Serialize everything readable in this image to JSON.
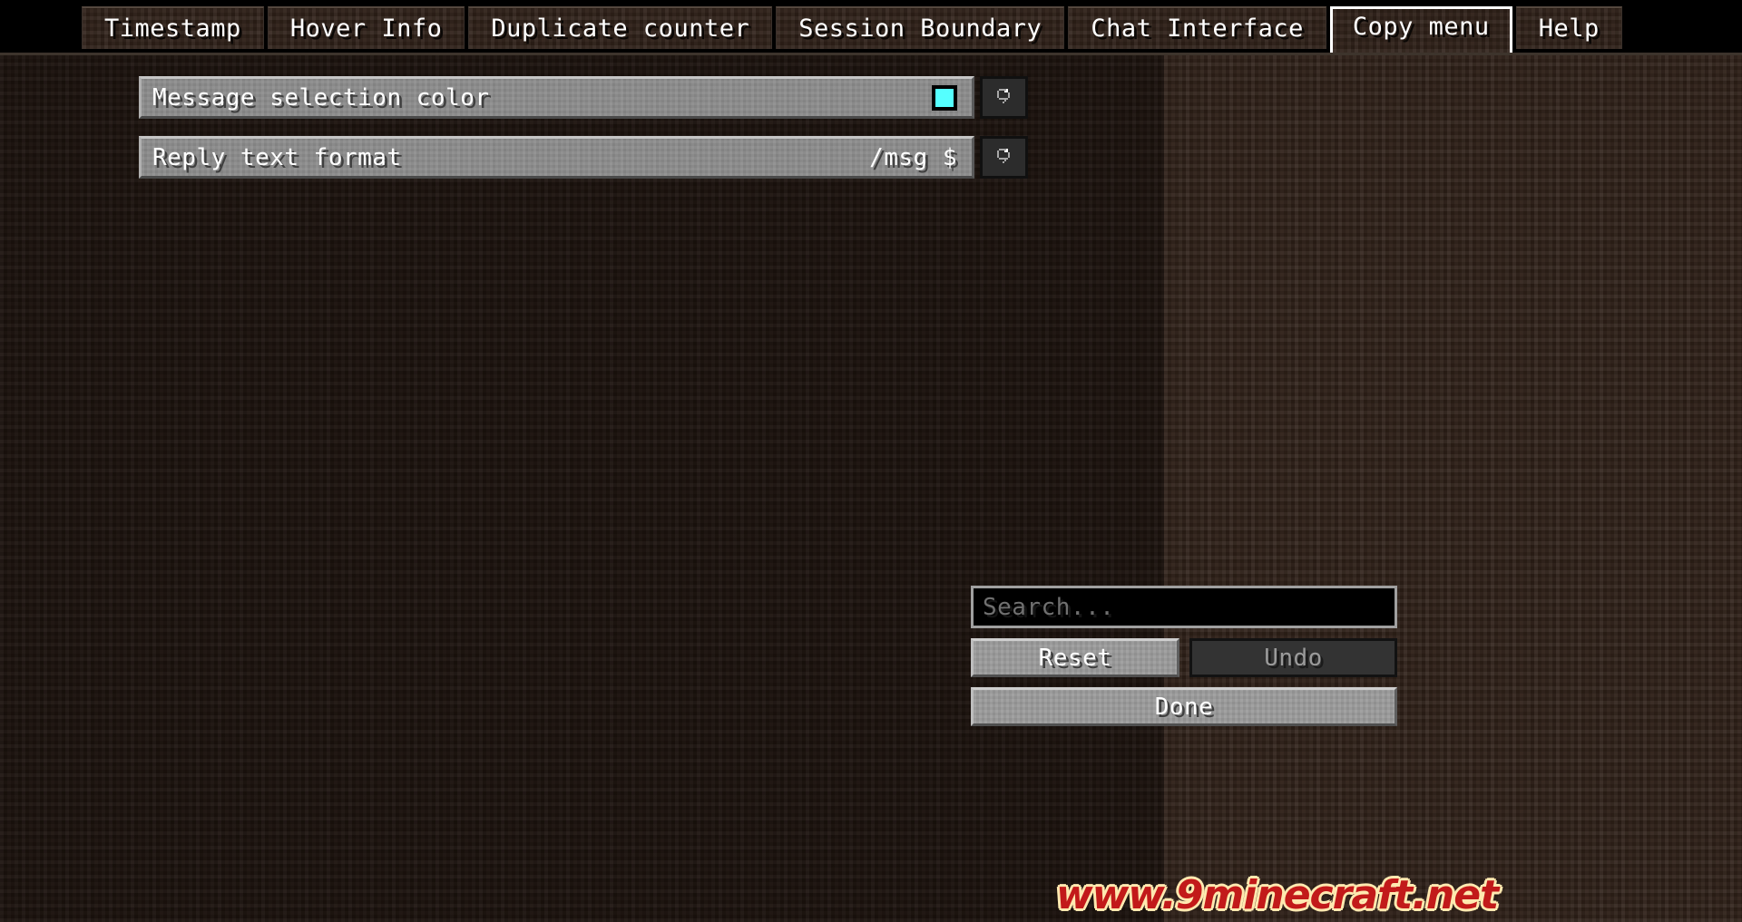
{
  "window": {
    "title": "Copy menu"
  },
  "colors": {
    "selection_swatch": "#55FFFF",
    "tab_selected_border": "#FFFFFF",
    "widget_face": "#8B8B8B",
    "panel_dirt": "#2E2018",
    "panel_dirt_dim": "#1B120D"
  },
  "tabs": [
    {
      "label": "Timestamp",
      "selected": false
    },
    {
      "label": "Hover Info",
      "selected": false
    },
    {
      "label": "Duplicate counter",
      "selected": false
    },
    {
      "label": "Session Boundary",
      "selected": false
    },
    {
      "label": "Chat Interface",
      "selected": false
    },
    {
      "label": "Copy menu",
      "selected": true
    },
    {
      "label": "Help",
      "selected": false
    }
  ],
  "config_rows": [
    {
      "label": "Message selection color",
      "value_type": "color",
      "value": "#55FFFF",
      "reset_icon": "reset-arrow-icon",
      "reset_enabled": false
    },
    {
      "label": "Reply text format",
      "value_type": "text",
      "value": "/msg $",
      "reset_icon": "reset-arrow-icon",
      "reset_enabled": false
    }
  ],
  "sidebar": {
    "search": {
      "value": "",
      "placeholder": "Search..."
    },
    "buttons": {
      "reset_label": "Reset",
      "undo_label": "Undo",
      "done_label": "Done",
      "reset_enabled": true,
      "undo_enabled": false,
      "done_enabled": true
    }
  },
  "watermark": {
    "text": "www.9minecraft.net"
  }
}
